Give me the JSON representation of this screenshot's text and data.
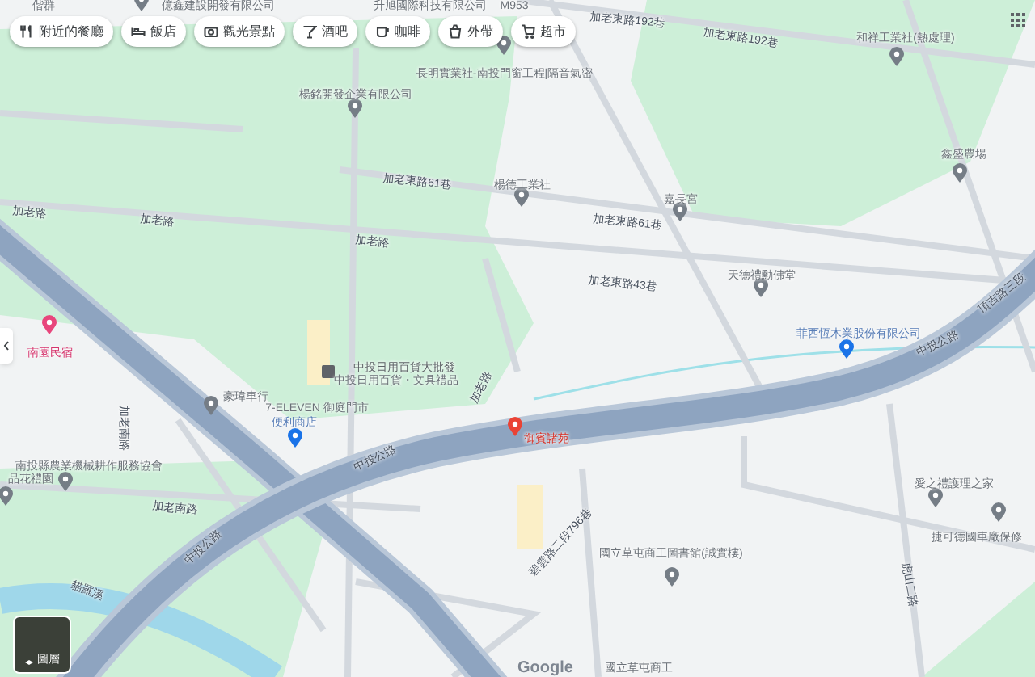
{
  "chips": [
    {
      "label": "附近的餐廳",
      "kind": "restaurant"
    },
    {
      "label": "飯店",
      "kind": "hotel"
    },
    {
      "label": "觀光景點",
      "kind": "camera"
    },
    {
      "label": "酒吧",
      "kind": "bar"
    },
    {
      "label": "咖啡",
      "kind": "coffee"
    },
    {
      "label": "外帶",
      "kind": "takeout"
    },
    {
      "label": "超市",
      "kind": "cart"
    }
  ],
  "road_labels": [
    "加老東路192巷",
    "加老東路192巷",
    "加老東路61巷",
    "加老路",
    "加老路",
    "加老路",
    "加老東路61巷",
    "加老東路43巷",
    "頂吉路三段",
    "中投公路",
    "加老路",
    "加老南路",
    "中投公路",
    "加老南路",
    "中投公路",
    "貓羅溪",
    "碧雲路二段796巷",
    "虎山二路"
  ],
  "places": [
    {
      "name": "偕群",
      "kind": "none"
    },
    {
      "name": "億鑫建設開發有限公司",
      "kind": "gray"
    },
    {
      "name": "升旭國際科技有限公司",
      "kind": "none"
    },
    {
      "name": "M953",
      "kind": "none"
    },
    {
      "name": "長明實業社-南投門窗工程|隔音氣密",
      "kind": "gray"
    },
    {
      "name": "和祥工業社(熱處理)",
      "kind": "gray"
    },
    {
      "name": "楊銘開發企業有限公司",
      "kind": "gray"
    },
    {
      "name": "楊德工業社",
      "kind": "gray"
    },
    {
      "name": "嘉長宮",
      "kind": "gray"
    },
    {
      "name": "鑫盛農場",
      "kind": "gray"
    },
    {
      "name": "天德禮勳佛堂",
      "kind": "gray"
    },
    {
      "name": "菲西恆木業股份有限公司",
      "kind": "blue"
    },
    {
      "name": "南園民宿",
      "kind": "pink"
    },
    {
      "name": "中投日用百貨大批發",
      "kind": "store"
    },
    {
      "name": "中投日用百貨・文具禮品",
      "kind": "none"
    },
    {
      "name": "豪瑋車行",
      "kind": "gray"
    },
    {
      "name": "7-ELEVEN 御庭門市",
      "kind": "none"
    },
    {
      "name": "便利商店",
      "kind": "blue"
    },
    {
      "name": "御賓諸苑",
      "kind": "red"
    },
    {
      "name": "南投縣農業機械耕作服務協會",
      "kind": "gray"
    },
    {
      "name": "品花禮園",
      "kind": "gray"
    },
    {
      "name": "國立草屯商工圖書館(誠實樓)",
      "kind": "gray"
    },
    {
      "name": "愛之禮護理之家",
      "kind": "gray"
    },
    {
      "name": "捷可德國車廠保修",
      "kind": "gray"
    },
    {
      "name": "國立草屯商工",
      "kind": "none"
    }
  ],
  "layers_button": {
    "label": "圖層"
  },
  "logo": "Google"
}
